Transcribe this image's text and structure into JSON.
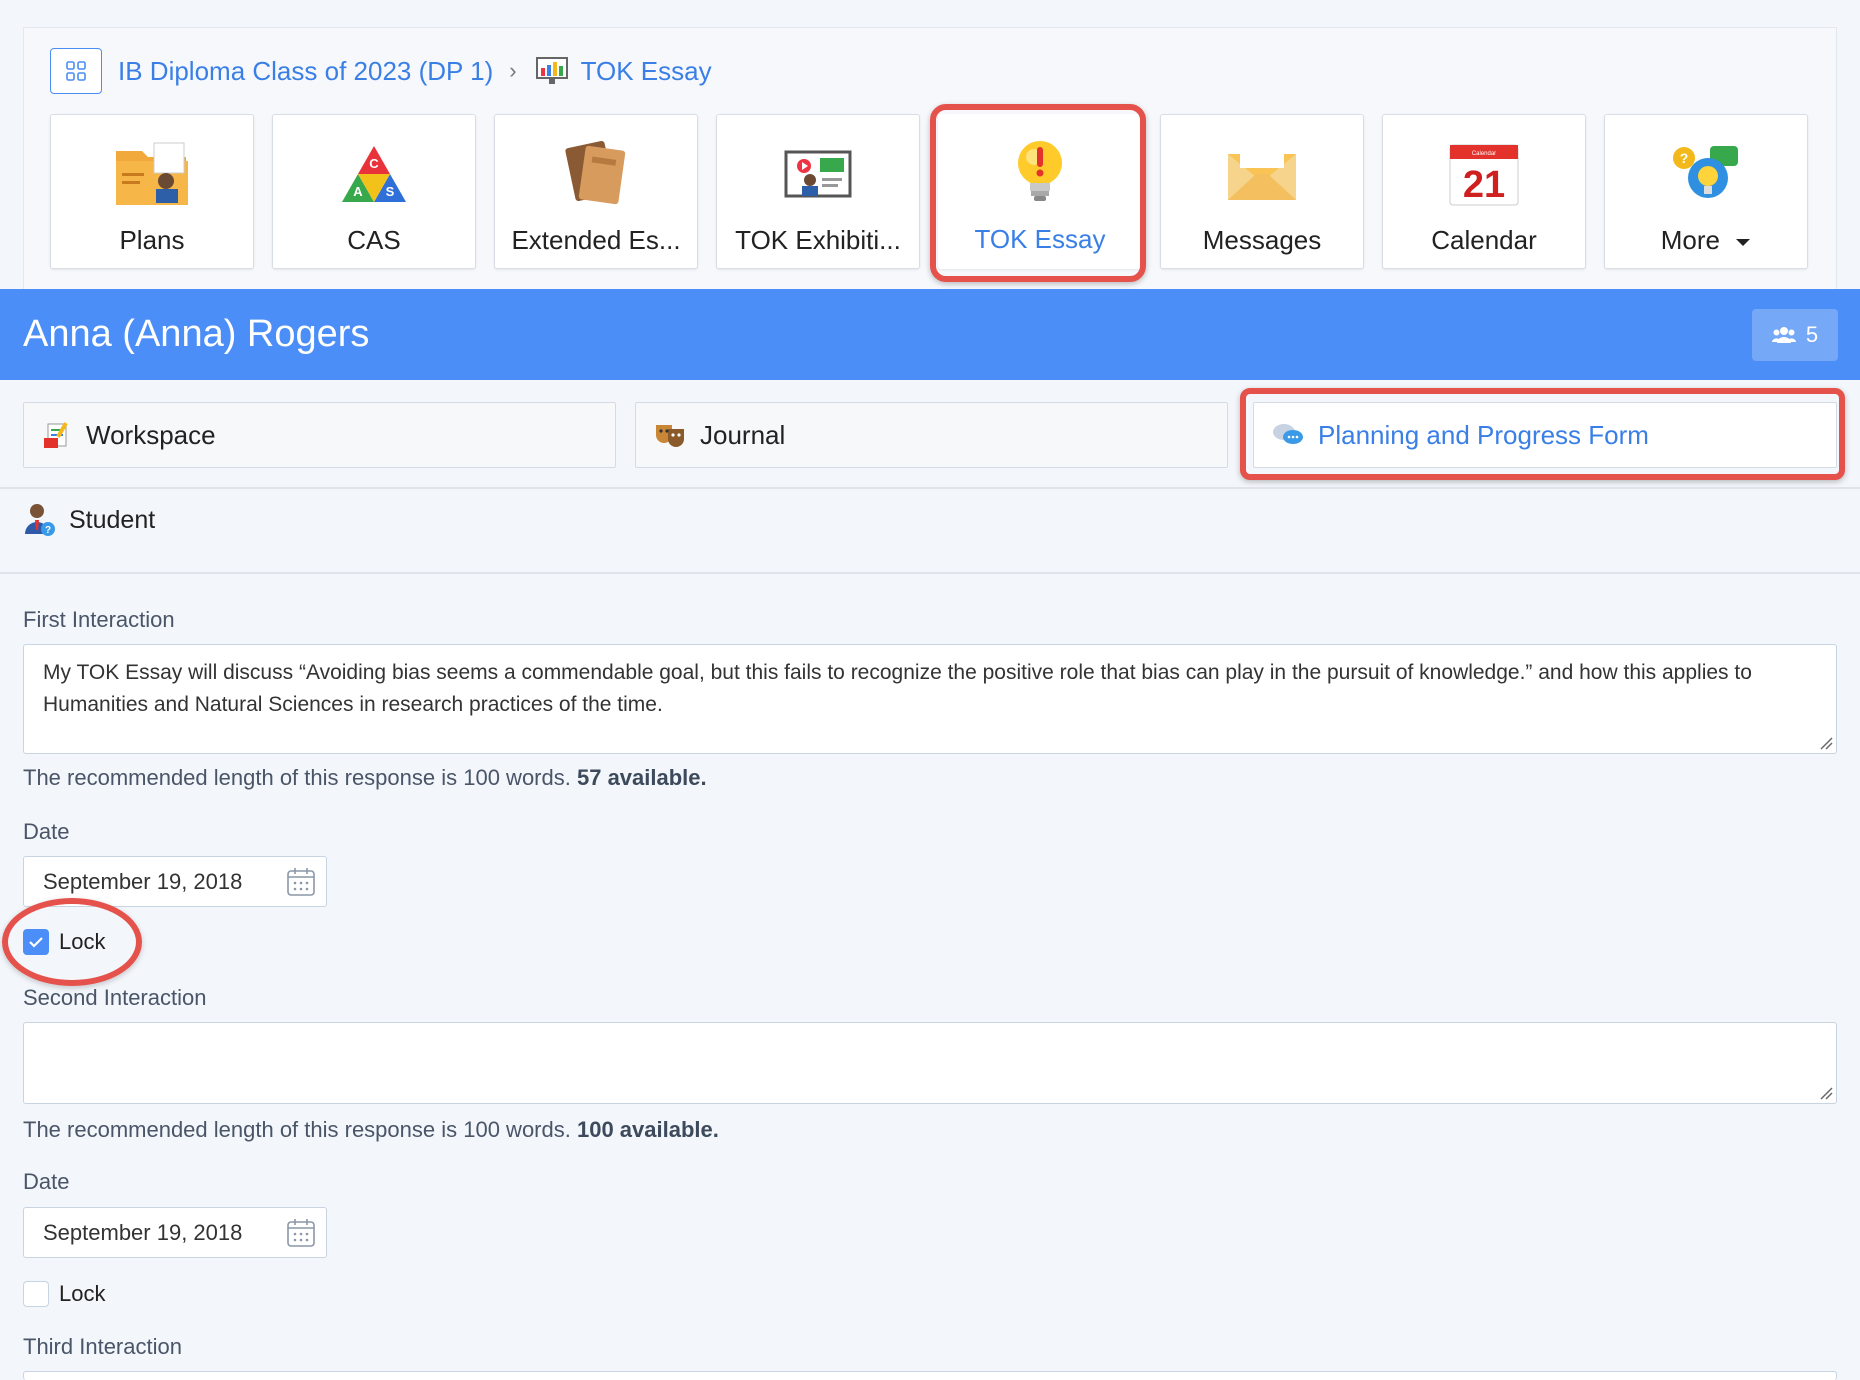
{
  "breadcrumb": {
    "class_label": "IB Diploma Class of 2023 (DP 1)",
    "current_label": "TOK Essay"
  },
  "tiles": [
    {
      "label": "Plans",
      "icon": "folder-plans-icon"
    },
    {
      "label": "CAS",
      "icon": "cas-triangle-icon",
      "icon_letters": [
        "C",
        "A",
        "S"
      ]
    },
    {
      "label": "Extended Es...",
      "icon": "extended-essay-book-icon"
    },
    {
      "label": "TOK Exhibiti...",
      "icon": "tok-exhibition-icon"
    },
    {
      "label": "TOK Essay",
      "icon": "lightbulb-icon",
      "active": true
    },
    {
      "label": "Messages",
      "icon": "envelope-icon"
    },
    {
      "label": "Calendar",
      "icon": "calendar-icon",
      "icon_text": "21",
      "icon_caption": "Calendar"
    },
    {
      "label": "More",
      "icon": "more-lightbulb-icon",
      "has_dropdown": true
    }
  ],
  "student": {
    "name": "Anna (Anna) Rogers",
    "group_count": "5"
  },
  "subtabs": [
    {
      "label": "Workspace",
      "icon": "workspace-icon"
    },
    {
      "label": "Journal",
      "icon": "journal-masks-icon"
    },
    {
      "label": "Planning and Progress Form",
      "icon": "speech-bubbles-icon",
      "active": true
    }
  ],
  "role": {
    "label": "Student",
    "icon": "student-avatar-icon"
  },
  "form": {
    "interactions": [
      {
        "title": "First Interaction",
        "value": "My TOK Essay will discuss “Avoiding bias seems a commendable goal, but this fails to recognize the positive role that bias can play in the pursuit of knowledge.” and how this applies to Humanities and Natural Sciences in research practices of the time.",
        "help_prefix": "The recommended length of this response is 100 words.",
        "help_available": "57 available.",
        "date_label": "Date",
        "date_value": "September 19, 2018",
        "lock_label": "Lock",
        "locked": true
      },
      {
        "title": "Second Interaction",
        "value": "",
        "help_prefix": "The recommended length of this response is 100 words.",
        "help_available": "100 available.",
        "date_label": "Date",
        "date_value": "September 19, 2018",
        "lock_label": "Lock",
        "locked": false
      },
      {
        "title": "Third Interaction"
      }
    ]
  },
  "colors": {
    "accent": "#4b8ef7",
    "link": "#3a7fe6",
    "highlight": "#e5524c"
  }
}
